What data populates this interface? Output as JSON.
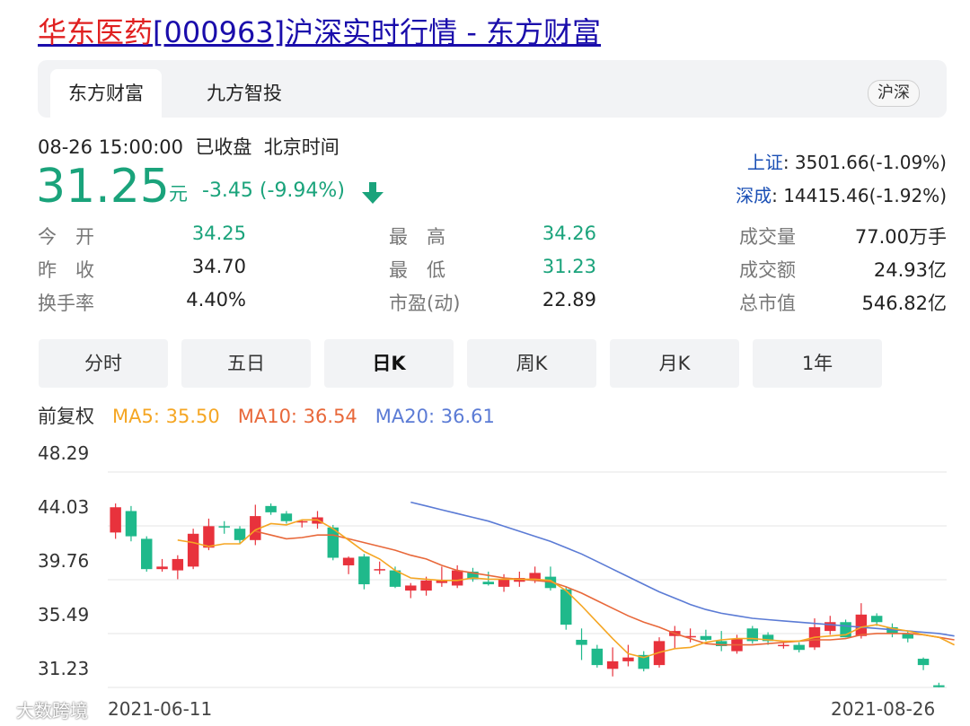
{
  "header": {
    "title_name": "华东医药",
    "title_rest": "[000963]沪深实时行情 - 东方财富"
  },
  "tabs": [
    {
      "label": "东方财富",
      "active": true
    },
    {
      "label": "九方智投",
      "active": false
    }
  ],
  "market_pill": "沪深",
  "quote": {
    "timestamp": "08-26 15:00:00",
    "status": "已收盘",
    "timezone": "北京时间",
    "price": "31.25",
    "unit": "元",
    "change": "-3.45 (-9.94%)",
    "direction_icon": "down-arrow-icon",
    "color_down": "#1aa37b"
  },
  "indices": [
    {
      "name": "上证",
      "value": ": 3501.66(-1.09%)"
    },
    {
      "name": "深成",
      "value": ": 14415.46(-1.92%)"
    }
  ],
  "stats": {
    "col1": [
      {
        "label": "今　开",
        "value": "34.25"
      },
      {
        "label": "昨　收",
        "value": "34.70"
      },
      {
        "label": "换手率",
        "value": "4.40%"
      }
    ],
    "col2": [
      {
        "label": "最　高",
        "value": "34.26"
      },
      {
        "label": "最　低",
        "value": "31.23"
      },
      {
        "label": "市盈(动)",
        "value": "22.89"
      }
    ],
    "col3": [
      {
        "label": "成交量",
        "value": "77.00万手"
      },
      {
        "label": "成交额",
        "value": "24.93亿"
      },
      {
        "label": "总市值",
        "value": "546.82亿"
      }
    ]
  },
  "period_buttons": [
    "分时",
    "五日",
    "日K",
    "周K",
    "月K",
    "1年"
  ],
  "active_period": "日K",
  "indicators": {
    "adjust": "前复权",
    "ma5": "MA5: 35.50",
    "ma10": "MA10: 36.54",
    "ma20": "MA20: 36.61",
    "ma5_color": "#f5a623",
    "ma10_color": "#e8683a",
    "ma20_color": "#5b7bd5"
  },
  "watermark": "大数跨境",
  "chart_data": {
    "type": "candlestick",
    "y_ticks": [
      "48.29",
      "44.03",
      "39.76",
      "35.49",
      "31.23"
    ],
    "ylim": [
      31.23,
      48.29
    ],
    "x_start_label": "2021-06-11",
    "x_end_label": "2021-08-26",
    "up_color": "#e8323c",
    "down_color": "#1fb98b",
    "candles": [
      {
        "o": 43.5,
        "h": 45.8,
        "l": 43.0,
        "c": 45.5
      },
      {
        "o": 45.2,
        "h": 45.6,
        "l": 42.8,
        "c": 43.2
      },
      {
        "o": 43.0,
        "h": 43.2,
        "l": 40.4,
        "c": 40.6
      },
      {
        "o": 40.6,
        "h": 41.4,
        "l": 40.4,
        "c": 40.8
      },
      {
        "o": 40.5,
        "h": 41.7,
        "l": 39.8,
        "c": 41.4
      },
      {
        "o": 40.8,
        "h": 43.8,
        "l": 40.6,
        "c": 43.4
      },
      {
        "o": 42.3,
        "h": 44.6,
        "l": 42.1,
        "c": 44.0
      },
      {
        "o": 44.0,
        "h": 44.4,
        "l": 43.4,
        "c": 43.9
      },
      {
        "o": 43.8,
        "h": 44.0,
        "l": 42.6,
        "c": 42.9
      },
      {
        "o": 42.9,
        "h": 45.7,
        "l": 42.5,
        "c": 44.8
      },
      {
        "o": 45.6,
        "h": 45.8,
        "l": 44.9,
        "c": 45.1
      },
      {
        "o": 45.0,
        "h": 45.2,
        "l": 44.2,
        "c": 44.4
      },
      {
        "o": 44.3,
        "h": 44.5,
        "l": 43.9,
        "c": 44.4
      },
      {
        "o": 44.2,
        "h": 45.2,
        "l": 43.8,
        "c": 44.7
      },
      {
        "o": 43.9,
        "h": 44.1,
        "l": 41.3,
        "c": 41.5
      },
      {
        "o": 40.9,
        "h": 41.6,
        "l": 40.2,
        "c": 41.5
      },
      {
        "o": 41.6,
        "h": 41.8,
        "l": 39.0,
        "c": 39.4
      },
      {
        "o": 40.5,
        "h": 41.2,
        "l": 40.2,
        "c": 40.6
      },
      {
        "o": 40.5,
        "h": 40.8,
        "l": 39.1,
        "c": 39.2
      },
      {
        "o": 38.9,
        "h": 39.5,
        "l": 38.3,
        "c": 39.3
      },
      {
        "o": 38.9,
        "h": 40.0,
        "l": 38.5,
        "c": 39.7
      },
      {
        "o": 39.5,
        "h": 40.8,
        "l": 39.2,
        "c": 39.7
      },
      {
        "o": 39.3,
        "h": 40.9,
        "l": 39.1,
        "c": 40.5
      },
      {
        "o": 40.4,
        "h": 40.7,
        "l": 39.6,
        "c": 39.8
      },
      {
        "o": 39.6,
        "h": 40.4,
        "l": 39.3,
        "c": 39.4
      },
      {
        "o": 39.2,
        "h": 40.2,
        "l": 38.8,
        "c": 39.8
      },
      {
        "o": 39.6,
        "h": 40.4,
        "l": 39.2,
        "c": 39.9
      },
      {
        "o": 39.8,
        "h": 40.8,
        "l": 39.5,
        "c": 40.3
      },
      {
        "o": 40.0,
        "h": 40.8,
        "l": 38.9,
        "c": 39.1
      },
      {
        "o": 39.0,
        "h": 39.2,
        "l": 35.8,
        "c": 36.2
      },
      {
        "o": 35.0,
        "h": 35.9,
        "l": 33.4,
        "c": 34.6
      },
      {
        "o": 34.3,
        "h": 34.6,
        "l": 32.8,
        "c": 33.0
      },
      {
        "o": 32.7,
        "h": 34.4,
        "l": 32.1,
        "c": 33.3
      },
      {
        "o": 33.3,
        "h": 34.6,
        "l": 32.9,
        "c": 33.6
      },
      {
        "o": 33.8,
        "h": 34.1,
        "l": 32.5,
        "c": 32.7
      },
      {
        "o": 33.0,
        "h": 35.2,
        "l": 32.8,
        "c": 34.9
      },
      {
        "o": 35.3,
        "h": 36.1,
        "l": 34.3,
        "c": 35.7
      },
      {
        "o": 35.2,
        "h": 35.9,
        "l": 34.8,
        "c": 35.3
      },
      {
        "o": 35.3,
        "h": 35.8,
        "l": 34.9,
        "c": 35.0
      },
      {
        "o": 34.9,
        "h": 35.7,
        "l": 34.1,
        "c": 34.5
      },
      {
        "o": 34.1,
        "h": 35.4,
        "l": 33.9,
        "c": 35.1
      },
      {
        "o": 35.9,
        "h": 36.1,
        "l": 34.7,
        "c": 34.9
      },
      {
        "o": 35.4,
        "h": 35.6,
        "l": 34.6,
        "c": 34.9
      },
      {
        "o": 34.5,
        "h": 34.9,
        "l": 34.3,
        "c": 34.6
      },
      {
        "o": 34.6,
        "h": 34.8,
        "l": 34.0,
        "c": 34.2
      },
      {
        "o": 34.4,
        "h": 36.7,
        "l": 34.2,
        "c": 36.0
      },
      {
        "o": 35.7,
        "h": 36.9,
        "l": 35.4,
        "c": 36.4
      },
      {
        "o": 36.4,
        "h": 36.6,
        "l": 35.2,
        "c": 35.2
      },
      {
        "o": 35.3,
        "h": 37.9,
        "l": 35.1,
        "c": 37.0
      },
      {
        "o": 36.9,
        "h": 37.1,
        "l": 36.1,
        "c": 36.4
      },
      {
        "o": 36.0,
        "h": 36.3,
        "l": 35.2,
        "c": 35.5
      },
      {
        "o": 35.5,
        "h": 35.7,
        "l": 34.8,
        "c": 35.1
      },
      {
        "o": 33.5,
        "h": 33.6,
        "l": 32.6,
        "c": 33.0
      },
      {
        "o": 31.4,
        "h": 31.6,
        "l": 31.23,
        "c": 31.25
      }
    ],
    "ma5": [
      null,
      null,
      null,
      null,
      42.9,
      42.7,
      42.4,
      42.6,
      42.6,
      43.7,
      44.2,
      44.1,
      44.5,
      44.5,
      43.8,
      42.9,
      42.0,
      41.4,
      40.5,
      39.9,
      39.8,
      39.7,
      39.7,
      39.9,
      39.8,
      39.8,
      39.8,
      39.8,
      39.7,
      38.9,
      37.7,
      36.4,
      35.1,
      33.9,
      33.6,
      34.0,
      34.3,
      34.4,
      34.8,
      35.0,
      35.1,
      35.1,
      35.0,
      34.9,
      34.9,
      35.2,
      35.3,
      35.4,
      36.0,
      36.2,
      35.9,
      35.7,
      35.4,
      35.2,
      34.6
    ],
    "ma10": [
      null,
      null,
      null,
      null,
      null,
      null,
      null,
      null,
      null,
      43.6,
      43.3,
      43.0,
      43.1,
      43.3,
      43.3,
      43.0,
      42.7,
      42.4,
      42.1,
      41.7,
      41.4,
      40.9,
      40.5,
      40.3,
      40.1,
      39.9,
      39.8,
      39.7,
      39.6,
      39.2,
      38.7,
      38.1,
      37.5,
      36.9,
      36.4,
      36.0,
      35.5,
      35.1,
      34.7,
      34.6,
      34.6,
      34.6,
      34.7,
      34.8,
      34.9,
      35.0,
      35.0,
      35.1,
      35.4,
      35.5,
      35.5,
      35.5,
      35.4,
      35.2,
      35.0
    ],
    "ma20": [
      null,
      null,
      null,
      null,
      null,
      null,
      null,
      null,
      null,
      null,
      null,
      null,
      null,
      null,
      null,
      null,
      null,
      null,
      null,
      45.9,
      45.6,
      45.3,
      45.0,
      44.7,
      44.4,
      44.0,
      43.6,
      43.2,
      42.8,
      42.3,
      41.8,
      41.2,
      40.6,
      40.0,
      39.4,
      38.8,
      38.3,
      37.8,
      37.4,
      37.1,
      36.9,
      36.7,
      36.6,
      36.5,
      36.4,
      36.3,
      36.2,
      36.1,
      36.0,
      35.9,
      35.8,
      35.7,
      35.6,
      35.5,
      35.3
    ]
  }
}
